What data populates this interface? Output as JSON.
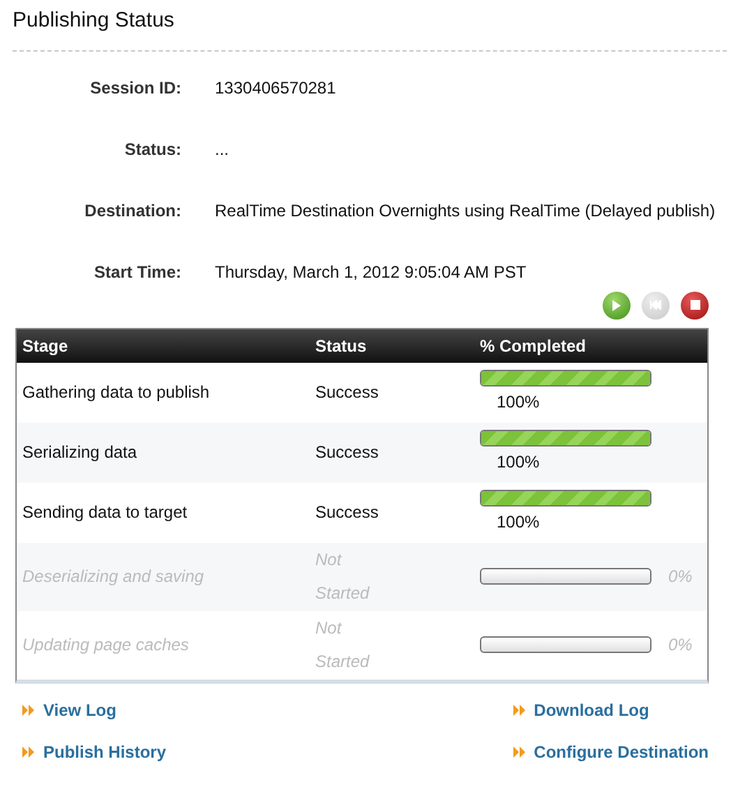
{
  "title": "Publishing Status",
  "fields": [
    {
      "label": "Session ID:",
      "value": "1330406570281"
    },
    {
      "label": "Status:",
      "value": "..."
    },
    {
      "label": "Destination:",
      "value": "RealTime Destination Overnights using RealTime (Delayed publish)"
    },
    {
      "label": "Start Time:",
      "value": "Thursday, March 1, 2012 9:05:04 AM PST"
    }
  ],
  "controls": [
    {
      "kind": "play",
      "disabled": false
    },
    {
      "kind": "rewind",
      "disabled": true
    },
    {
      "kind": "stop",
      "disabled": false
    }
  ],
  "table": {
    "columns": [
      "Stage",
      "Status",
      "% Completed"
    ],
    "rows": [
      {
        "stage": "Gathering data to publish",
        "status": "Success",
        "level": 1,
        "percent": "100%",
        "disabled": false
      },
      {
        "stage": "Serializing data",
        "status": "Success",
        "level": 1,
        "percent": "100%",
        "disabled": false
      },
      {
        "stage": "Sending data to target",
        "status": "Success",
        "level": 1,
        "percent": "100%",
        "disabled": false
      },
      {
        "stage": "Deserializing and saving",
        "status": "Not Started",
        "level": 0,
        "percent": "0%",
        "disabled": true
      },
      {
        "stage": "Updating page caches",
        "status": "Not Started",
        "level": 0,
        "percent": "0%",
        "disabled": true
      }
    ]
  },
  "links": [
    {
      "label": "View Log"
    },
    {
      "label": "Download Log"
    },
    {
      "label": "Publish History"
    },
    {
      "label": "Configure Destination"
    }
  ]
}
